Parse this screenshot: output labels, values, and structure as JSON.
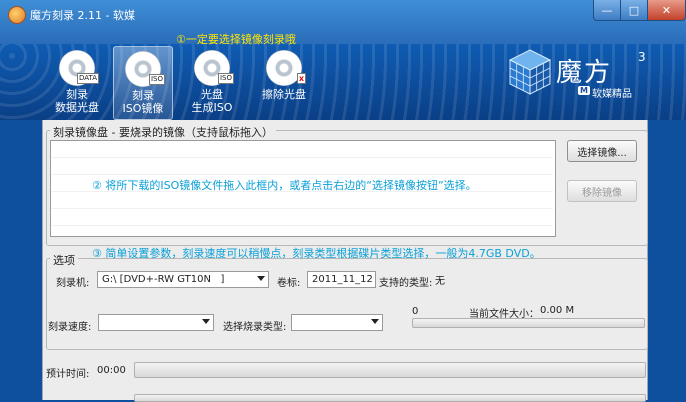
{
  "window": {
    "title": "魔方刻录 2.11 - 软媒",
    "controls": [
      "minimize",
      "maximize",
      "close"
    ]
  },
  "toolbar": {
    "hint": "①一定要选择镜像刻录哦",
    "items": [
      {
        "icon": "data-disc-icon",
        "tag": "DATA",
        "line1": "刻录",
        "line2": "数据光盘",
        "active": false
      },
      {
        "icon": "iso-disc-icon",
        "tag": "ISO",
        "line1": "刻录",
        "line2": "ISO镜像",
        "active": true
      },
      {
        "icon": "iso-generate-icon",
        "tag": "ISO",
        "line1": "光盘",
        "line2": "生成ISO",
        "active": false
      },
      {
        "icon": "erase-disc-icon",
        "tag": "x",
        "line1": "擦除光盘",
        "line2": "",
        "active": false
      }
    ]
  },
  "logo": {
    "name": "魔方",
    "sup": "3",
    "badge": "M",
    "sub": "软媒精品"
  },
  "images_group": {
    "label": "刻录镜像盘 - 要烧录的镜像（支持鼠标拖入）",
    "hint": "② 将所下载的ISO镜像文件拖入此框内，或者点击右边的“选择镜像按钮”选择。",
    "select_button": "选择镜像...",
    "remove_button": "移除镜像"
  },
  "options_group": {
    "label": "选项",
    "hint": "③ 简单设置参数，刻录速度可以稍慢点，刻录类型根据碟片类型选择，一般为4.7GB DVD。",
    "burner_label": "刻录机:",
    "burner_value": "G:\\ [DVD+-RW GT10N   ]",
    "volume_label": "卷标:",
    "volume_value": "2011_11_12",
    "disc_type_label": "支持的类型:",
    "disc_type_value": "无",
    "speed_label": "刻录速度:",
    "speed_value": "",
    "burn_type_label": "选择烧录类型:",
    "burn_type_value": "",
    "progress_caption": "0",
    "file_size_label": "当前文件大小：",
    "file_size_value": "0.00 M",
    "file_progress": 0
  },
  "status": {
    "time_label": "预计时间:",
    "time_value": "00:00",
    "total_progress": 0
  }
}
